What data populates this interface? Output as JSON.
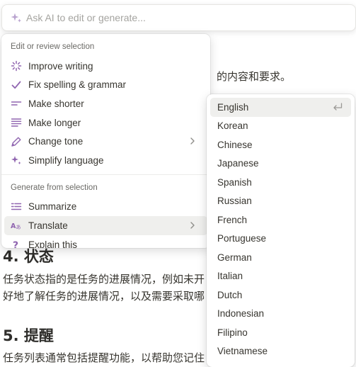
{
  "ai_bar": {
    "placeholder": "Ask AI to edit or generate..."
  },
  "document": {
    "line_top_fragment": "的内容和要求。",
    "heading_status": "4. 状态",
    "para_status_1": "任务状态指的是任务的进展情况，例如未开",
    "para_status_2": "好地了解任务的进展情况，以及需要采取哪",
    "heading_reminder": "5. 提醒",
    "para_reminder_1": "任务列表通常包括提醒功能，以帮助您记住"
  },
  "menu": {
    "section_edit": "Edit or review selection",
    "edit_items": [
      {
        "label": "Improve writing",
        "icon": "sparkle-burst-icon"
      },
      {
        "label": "Fix spelling & grammar",
        "icon": "checkmark-icon"
      },
      {
        "label": "Make shorter",
        "icon": "short-lines-icon"
      },
      {
        "label": "Make longer",
        "icon": "long-lines-icon"
      },
      {
        "label": "Change tone",
        "icon": "pen-nib-icon"
      },
      {
        "label": "Simplify language",
        "icon": "sparkle-icon"
      }
    ],
    "section_generate": "Generate from selection",
    "generate_items": [
      {
        "label": "Summarize",
        "icon": "summary-lines-icon"
      },
      {
        "label": "Translate",
        "icon": "translate-icon"
      },
      {
        "label": "Explain this",
        "icon": "question-icon"
      }
    ]
  },
  "languages": [
    "English",
    "Korean",
    "Chinese",
    "Japanese",
    "Spanish",
    "Russian",
    "French",
    "Portuguese",
    "German",
    "Italian",
    "Dutch",
    "Indonesian",
    "Filipino",
    "Vietnamese"
  ],
  "colors": {
    "accent_purple": "#9065b0",
    "hover_bg": "#efefed",
    "text": "#37352f",
    "muted": "#6b6a66"
  }
}
